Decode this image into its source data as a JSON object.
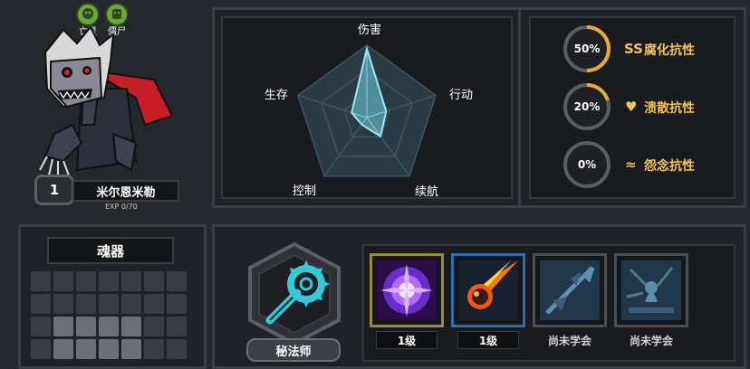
{
  "character": {
    "tags": [
      {
        "label": "亡灵",
        "icon": "skull-icon"
      },
      {
        "label": "僵尸",
        "icon": "zombie-icon"
      }
    ],
    "level": "1",
    "name": "米尔恩米勒",
    "exp": "EXP 0/70"
  },
  "radar": {
    "stats": [
      {
        "label": "伤害",
        "value": 0.95
      },
      {
        "label": "行动",
        "value": 0.28
      },
      {
        "label": "续航",
        "value": 0.32
      },
      {
        "label": "控制",
        "value": 0.12
      },
      {
        "label": "生存",
        "value": 0.22
      }
    ],
    "fill_color": "#5fa8b8",
    "stroke_color": "#9fe8f4"
  },
  "resistances": [
    {
      "value": "50%",
      "label": "腐化抗性",
      "icon": "corrosion-icon",
      "icon_glyph": "SS",
      "fraction": 0.5
    },
    {
      "value": "20%",
      "label": "溃散抗性",
      "icon": "heart-icon",
      "icon_glyph": "♥",
      "fraction": 0.2
    },
    {
      "value": "0%",
      "label": "怨念抗性",
      "icon": "wave-icon",
      "icon_glyph": "≈",
      "fraction": 0.0
    }
  ],
  "soul": {
    "title": "魂器"
  },
  "class": {
    "name": "秘法师",
    "icon": "arcane-staff-icon"
  },
  "skills": [
    {
      "name": "void-orb-skill",
      "level": "1级",
      "state": "learned"
    },
    {
      "name": "meteor-skill",
      "level": "1级",
      "state": "learned"
    },
    {
      "name": "ice-spear-skill",
      "level": "尚未学会",
      "state": "locked"
    },
    {
      "name": "frost-summon-skill",
      "level": "尚未学会",
      "state": "locked"
    }
  ],
  "colors": {
    "accent_gold": "#f2c35a",
    "ring_progress": "#e8a93a",
    "panel_bg": "#1f2226"
  }
}
